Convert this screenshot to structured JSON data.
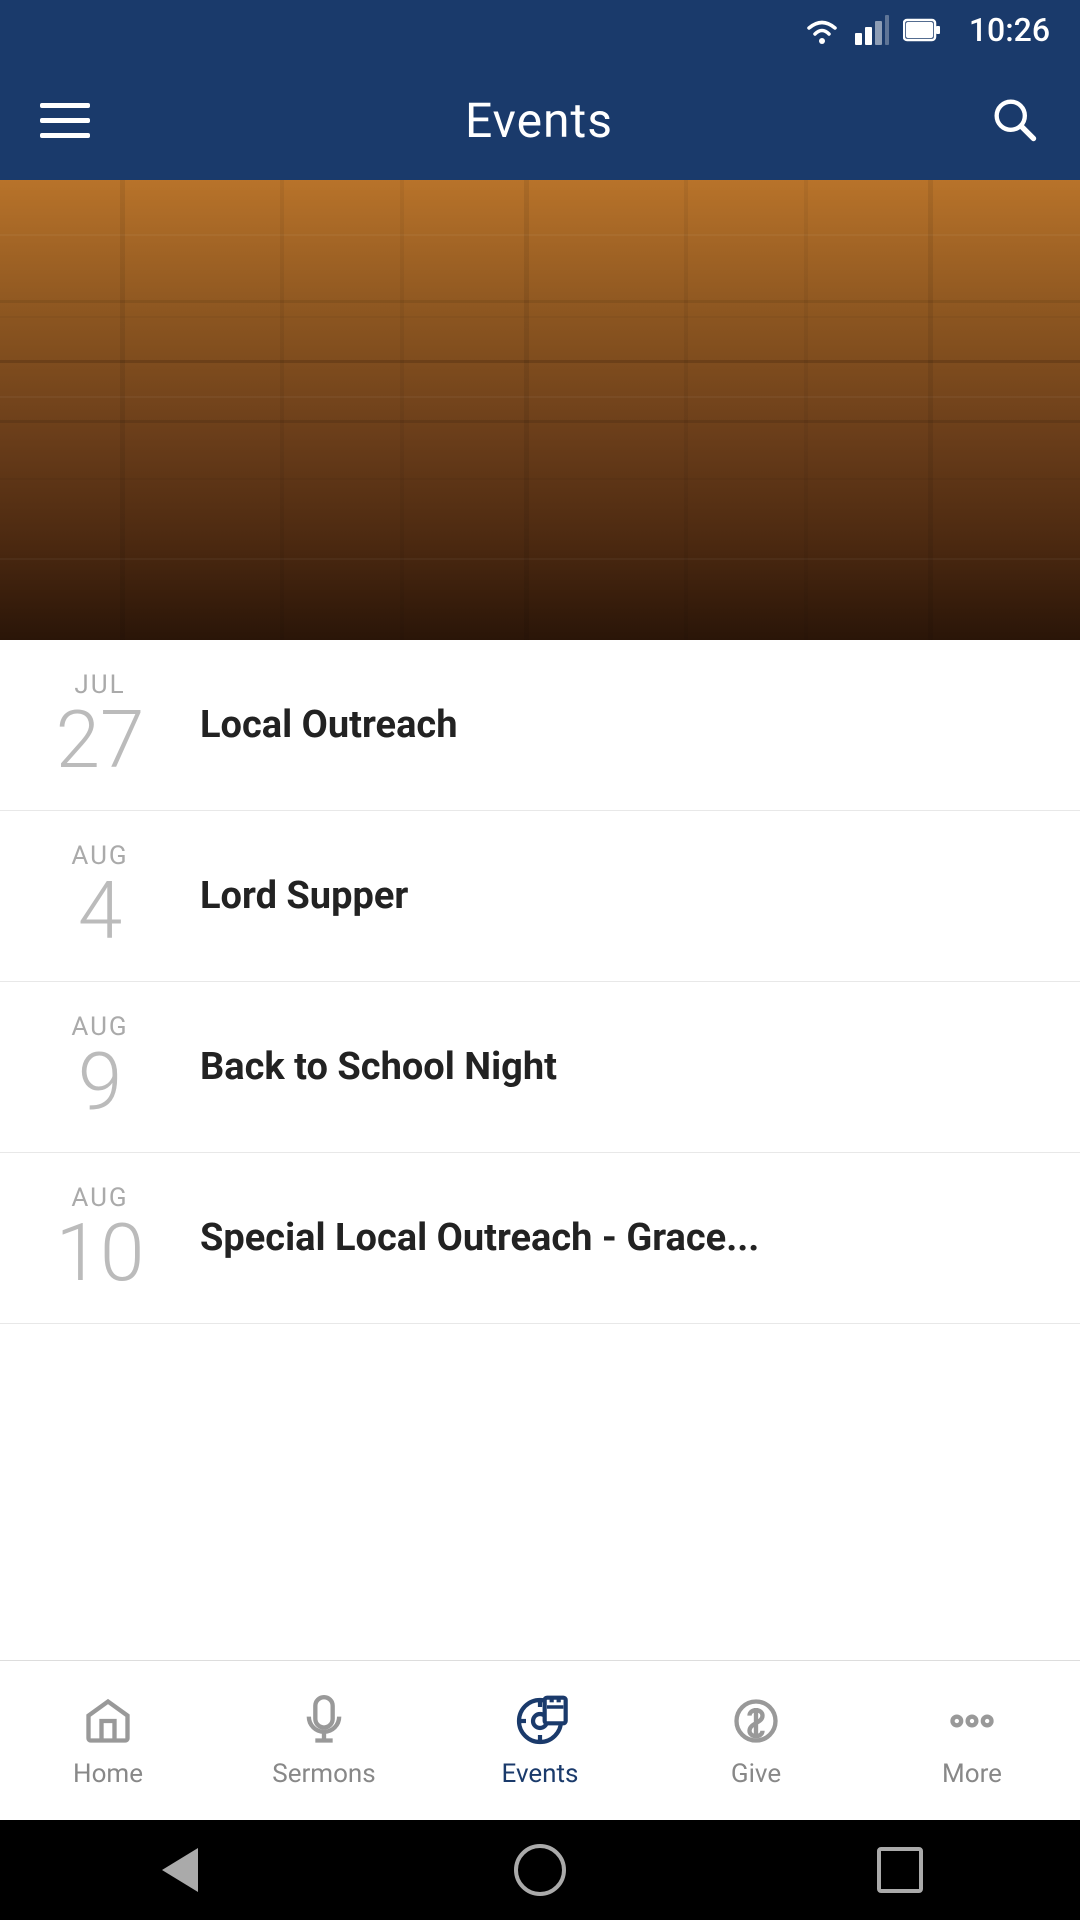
{
  "statusBar": {
    "time": "10:26"
  },
  "header": {
    "title": "Events",
    "menuLabel": "Menu",
    "searchLabel": "Search"
  },
  "events": [
    {
      "month": "JUL",
      "day": "27",
      "title": "Local Outreach"
    },
    {
      "month": "AUG",
      "day": "4",
      "title": "Lord Supper"
    },
    {
      "month": "AUG",
      "day": "9",
      "title": "Back to School Night"
    },
    {
      "month": "AUG",
      "day": "10",
      "title": "Special Local Outreach - Grace..."
    }
  ],
  "tabs": [
    {
      "id": "home",
      "label": "Home",
      "active": false
    },
    {
      "id": "sermons",
      "label": "Sermons",
      "active": false
    },
    {
      "id": "events",
      "label": "Events",
      "active": true
    },
    {
      "id": "give",
      "label": "Give",
      "active": false
    },
    {
      "id": "more",
      "label": "More",
      "active": false
    }
  ]
}
